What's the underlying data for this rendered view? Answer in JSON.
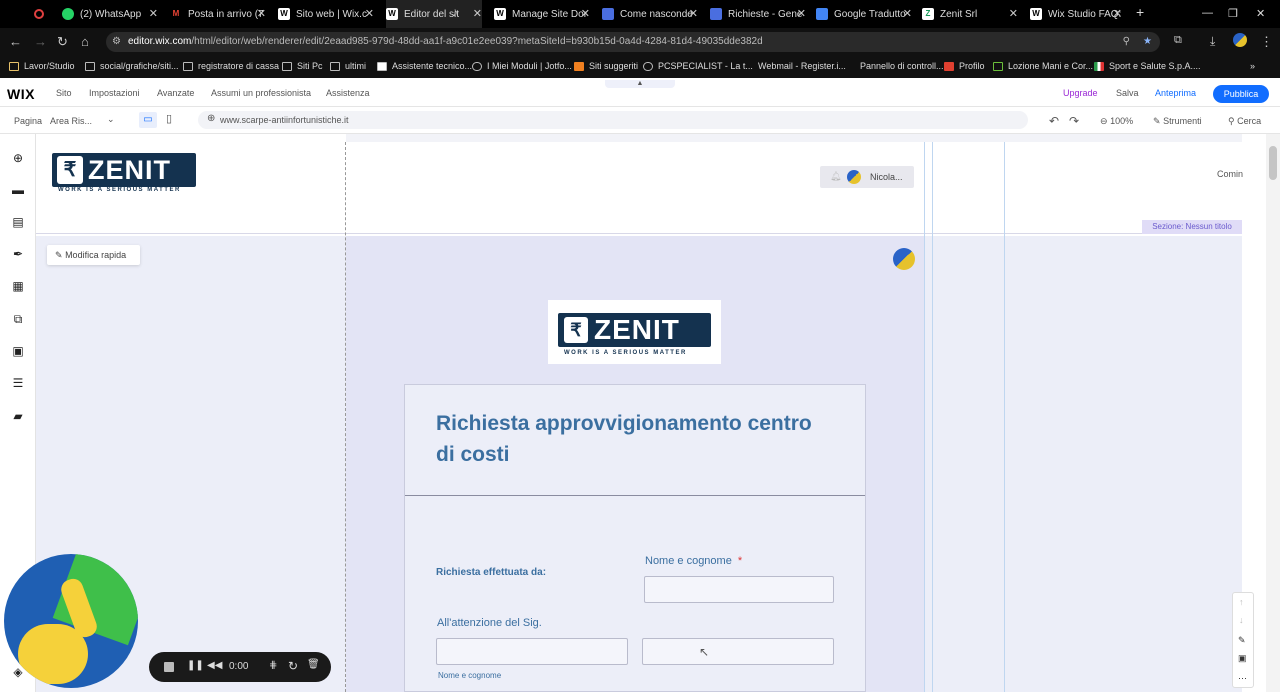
{
  "tabs": [
    {
      "label": "(2) WhatsApp",
      "icon": "whatsapp-icon"
    },
    {
      "label": "Posta in arrivo (7",
      "icon": "gmail-icon"
    },
    {
      "label": "Sito web | Wix.c",
      "icon": "wix-icon"
    },
    {
      "label": "Editor del sit",
      "icon": "wix-icon"
    },
    {
      "label": "Manage Site Dor",
      "icon": "wix-icon"
    },
    {
      "label": "Come nasconde",
      "icon": "wix-icon"
    },
    {
      "label": "Richieste - Gene",
      "icon": "form-icon"
    },
    {
      "label": "Google Tradutto",
      "icon": "translate-icon"
    },
    {
      "label": "Zenit Srl",
      "icon": "zenit-icon"
    },
    {
      "label": "Wix Studio FAQ:",
      "icon": "wix-icon"
    }
  ],
  "address": {
    "domain": "editor.wix.com",
    "path": "/html/editor/web/renderer/edit/2eaad985-979d-48dd-aa1f-a9c01e2ee039?metaSiteId=b930b15d-0a4d-4284-81d4-49035dde382d"
  },
  "bookmarks": [
    "Lavor/Studio",
    "social/grafiche/siti...",
    "registratore di cassa",
    "Siti Pc",
    "ultimi",
    "Assistente tecnico...",
    "I Miei Moduli | Jotfo...",
    "Siti suggeriti",
    "PCSPECIALIST - La t...",
    "Webmail - Register.i...",
    "Pannello di controll...",
    "Profilo",
    "Lozione Mani e Cor...",
    "Sport e Salute S.p.A...."
  ],
  "wix": {
    "logo": "WIX",
    "menu": [
      "Sito",
      "Impostazioni",
      "Avanzate",
      "Assumi un professionista",
      "Assistenza"
    ],
    "upgrade": "Upgrade",
    "save": "Salva",
    "preview": "Anteprima",
    "publish": "Pubblica"
  },
  "toolbar": {
    "page_label": "Pagina",
    "page_value": "Area Ris...",
    "site_url": "www.scarpe-antiinfortunistiche.it",
    "zoom": "100%",
    "tools": "Strumenti",
    "search": "Cerca"
  },
  "canvas": {
    "logo_text": "ZENIT",
    "logo_tagline": "WORK IS A SERIOUS MATTER",
    "user_menu": "Nicola...",
    "header_right_text": "Comin",
    "section_label": "Sezione: Nessun titolo",
    "quick_edit": "Modifica rapida"
  },
  "form": {
    "title": "Richiesta approvvigionamento centro di costi",
    "requested_by": "Richiesta effettuata da:",
    "name_label": "Nome e cognome",
    "required_mark": "*",
    "attention_label": "All'attenzione del Sig.",
    "sub_name_label": "Nome e cognome"
  },
  "recorder": {
    "time": "0:00"
  },
  "colors": {
    "accent": "#116dff",
    "form_title": "#3b6fa0",
    "upgrade": "#9a27d5"
  }
}
